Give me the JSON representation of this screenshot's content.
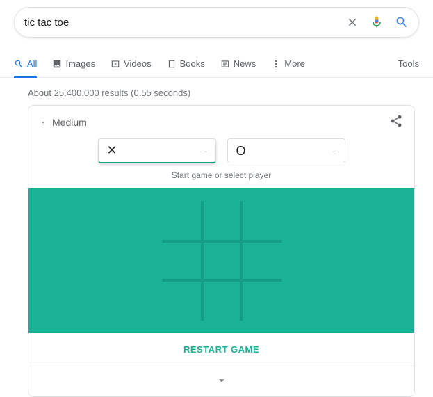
{
  "search": {
    "query": "tic tac toe"
  },
  "tabs": {
    "all": "All",
    "images": "Images",
    "videos": "Videos",
    "books": "Books",
    "news": "News",
    "more": "More",
    "tools": "Tools"
  },
  "stats": "About 25,400,000 results (0.55 seconds)",
  "game": {
    "difficulty": "Medium",
    "player_x": {
      "mark": "✕",
      "score": "-"
    },
    "player_o": {
      "mark": "O",
      "score": "-"
    },
    "hint": "Start game or select player",
    "restart": "RESTART GAME"
  },
  "colors": {
    "board": "#1bb196",
    "grid": "#149c85",
    "accent": "#1a73e8"
  }
}
